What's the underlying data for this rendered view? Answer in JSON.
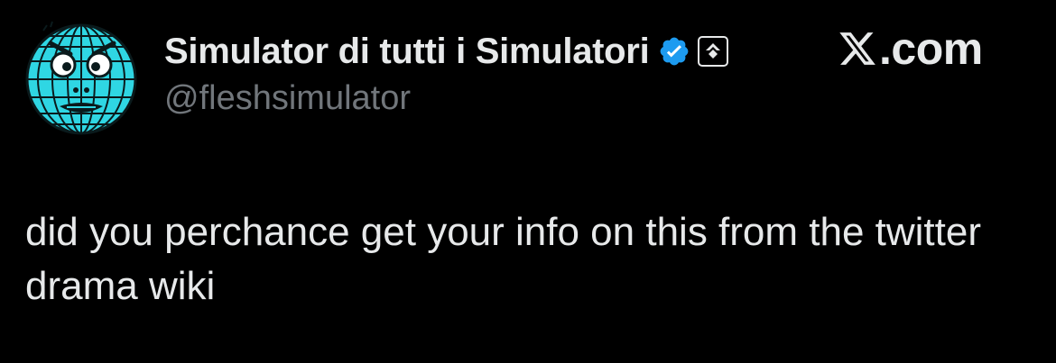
{
  "tweet": {
    "display_name": "Simulator di tutti i Simulatori",
    "handle": "@fleshsimulator",
    "text": "did you perchance get your info on this from the twitter drama wiki",
    "verified": true
  },
  "watermark": {
    "text": ".com"
  },
  "colors": {
    "background": "#000000",
    "text": "#e7e9ea",
    "muted": "#71767b",
    "verified_blue": "#1d9bf0",
    "avatar_cyan": "#2fd6e3"
  },
  "icons": {
    "avatar": "globe-face-avatar",
    "verified": "verified-badge-icon",
    "affiliate": "affiliate-badge-icon",
    "brand": "x-logo-icon"
  }
}
